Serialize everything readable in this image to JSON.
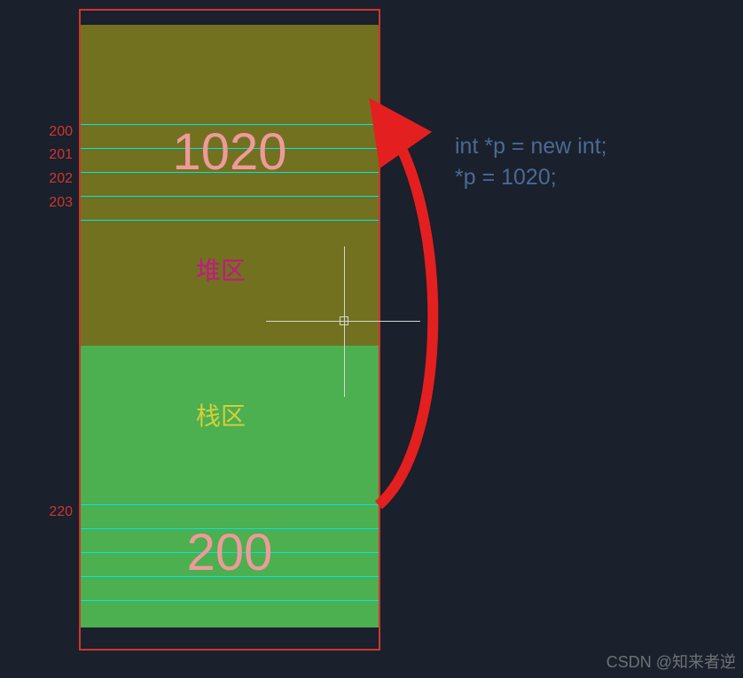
{
  "diagram": {
    "heap": {
      "label": "堆区",
      "value": "1020",
      "addresses": [
        "200",
        "201",
        "202",
        "203"
      ]
    },
    "stack": {
      "label": "栈区",
      "value": "200",
      "addresses": [
        "220"
      ]
    },
    "code": {
      "line1": "int *p = new int;",
      "line2": "*p = 1020;"
    },
    "watermark": "CSDN @知来者逆"
  }
}
